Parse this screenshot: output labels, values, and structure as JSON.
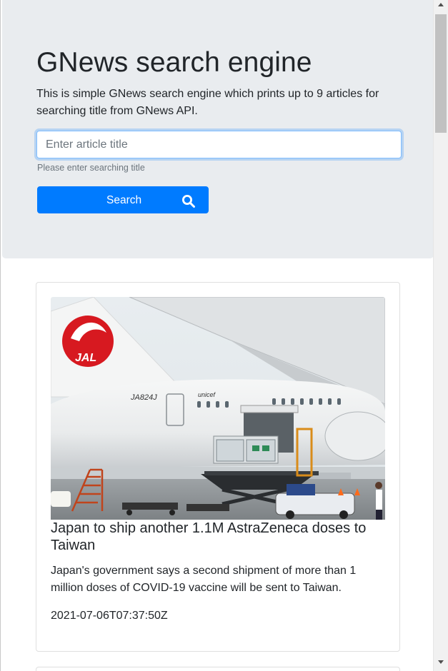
{
  "header": {
    "title": "GNews search engine",
    "description": "This is simple GNews search engine which prints up to 9 articles for searching title from GNews API."
  },
  "search": {
    "placeholder": "Enter article title",
    "value": "",
    "help_text": "Please enter searching title",
    "button_label": "Search",
    "button_icon": "search-icon"
  },
  "articles": [
    {
      "image_alt": "JAL airplane JA824J being loaded with vaccine cargo",
      "image_text": [
        "JAL",
        "JA824J",
        "unicef"
      ],
      "title": "Japan to ship another 1.1M AstraZeneca doses to Taiwan",
      "description": "Japan's government says a second shipment of more than 1 million doses of COVID-19 vaccine will be sent to Taiwan.",
      "published_at": "2021-07-06T07:37:50Z"
    }
  ],
  "colors": {
    "primary": "#007bff",
    "jumbotron": "#e9ecef",
    "text": "#212529",
    "muted": "#6c757d",
    "jal_red": "#d71920"
  }
}
